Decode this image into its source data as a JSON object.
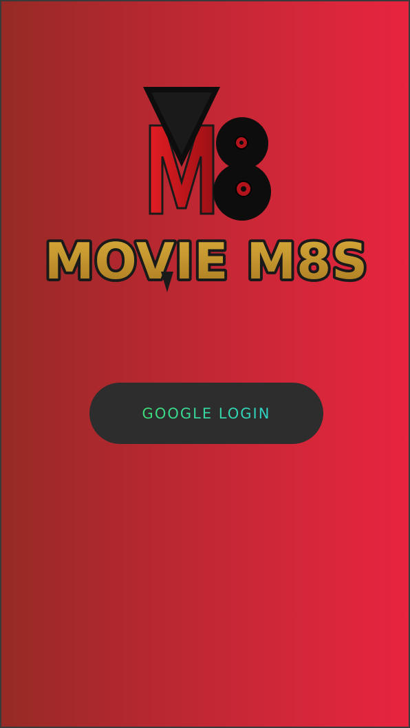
{
  "app": {
    "brand_name": "MOVIE M8S",
    "logo_monogram": "M8"
  },
  "login": {
    "google_button_label": "GOOGLE LOGIN"
  },
  "colors": {
    "background_gradient_start": "#962a25",
    "background_gradient_end": "#e8243f",
    "button_background": "#2d2d2d",
    "button_text_start": "#3edc7a",
    "button_text_end": "#2fd4c8",
    "wordmark_gold": "#c2952e",
    "logo_black": "#0d0d0d",
    "logo_red": "#c4161c"
  }
}
